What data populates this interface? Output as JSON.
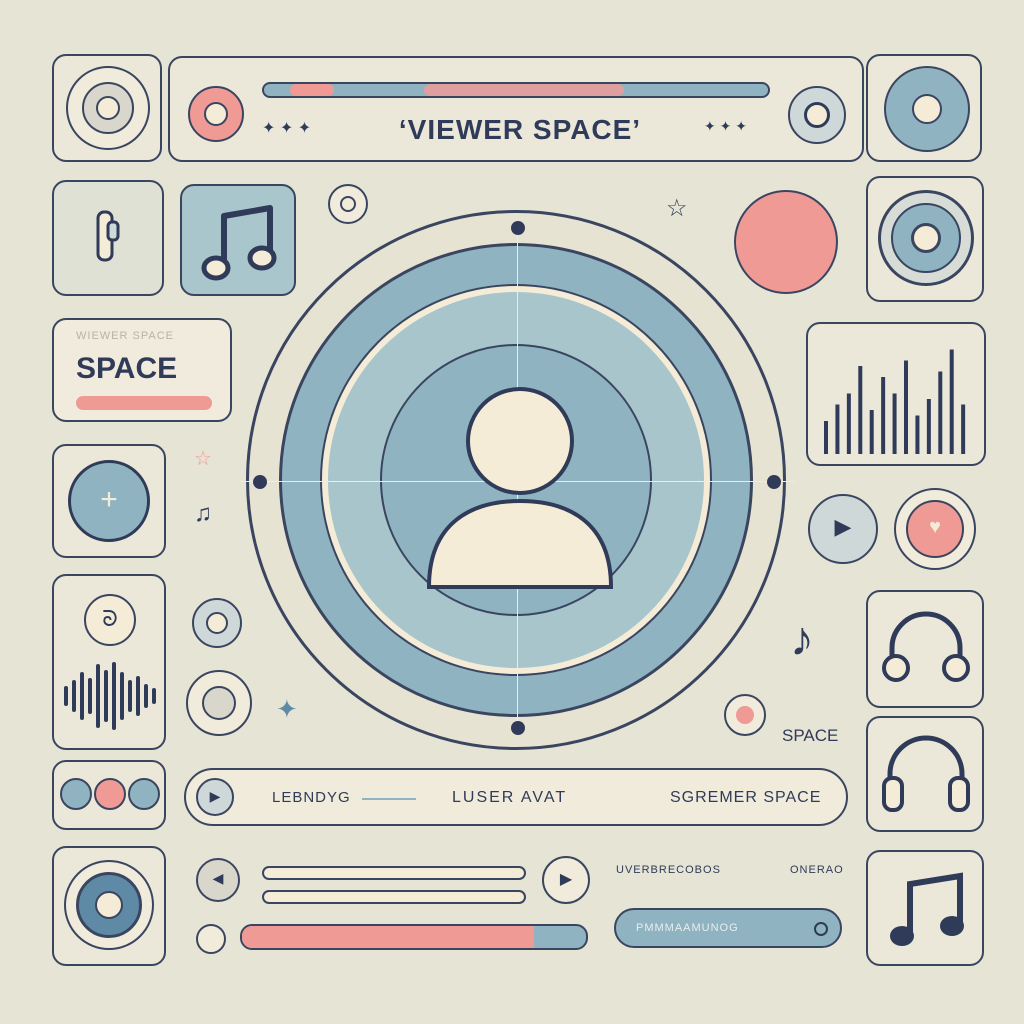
{
  "header": {
    "title": "‘VIEWER SPACE’",
    "accent_color": "#f09a96",
    "tone_color": "#8fb3c0"
  },
  "left_card": {
    "title": "SPACE",
    "faded_caption": "WIEWER SPACE"
  },
  "right_panel": {
    "equalizer_bars": [
      0.3,
      0.45,
      0.55,
      0.8,
      0.4,
      0.7,
      0.55,
      0.85,
      0.35,
      0.5,
      0.75,
      0.95,
      0.45
    ]
  },
  "side_labels": {
    "space_label": "SPACE"
  },
  "now_playing_bar": {
    "left_label": "LEBNDYG",
    "center_label": "LUSER AVAT",
    "right_label": "SGREMER SPACE"
  },
  "bottom_controls": {
    "meta_left": "UVERBRECOBOS",
    "meta_right": "ONERAO",
    "progress": 0.85,
    "pill_label": "PMMMAAMUNOG"
  },
  "colors": {
    "background": "#e6e4d5",
    "ink": "#2f3b58",
    "blue": "#8fb3c0",
    "pink": "#f09a96",
    "cream": "#f4ecd6"
  },
  "icons": [
    "speaker-icon",
    "record-icon",
    "music-note-icon",
    "phone-icon",
    "headphones-icon",
    "user-avatar-icon",
    "play-icon",
    "star-icon",
    "add-icon",
    "waveform-icon",
    "equalizer-icon"
  ]
}
